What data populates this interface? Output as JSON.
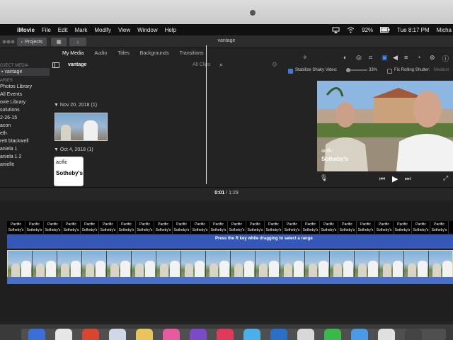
{
  "menubar": {
    "apple": "",
    "app_name": "iMovie",
    "items": [
      "File",
      "Edit",
      "Mark",
      "Modify",
      "View",
      "Window",
      "Help"
    ],
    "battery": "92%",
    "time": "Tue 8:17 PM",
    "user": "Micha"
  },
  "toolbar": {
    "projects_label": "Projects",
    "project_title": "vantage"
  },
  "browser": {
    "tabs": [
      "My Media",
      "Audio",
      "Titles",
      "Backgrounds",
      "Transitions"
    ],
    "library_name": "vantage",
    "filter": "All Clips"
  },
  "sidebar": {
    "header1": "OJECT MEDIA",
    "header2": "ARIES",
    "items": [
      "vantage",
      "Photos Library",
      "All Events",
      "ovie Library",
      "solutions",
      "2-26-15",
      "acon",
      "eth",
      "rett blackwell",
      "aniela 1",
      "aniela 1 2",
      "anielle"
    ]
  },
  "events": [
    {
      "date": "Nov 20, 2018",
      "count": "(1)"
    },
    {
      "date": "Oct 4, 2018",
      "count": "(1)"
    }
  ],
  "thumbs": {
    "pacific_text": "acific",
    "sothebys_text": "Sotheby's"
  },
  "viewer": {
    "stabilize_label": "Stabilize Shaky Video:",
    "stabilize_value": "33%",
    "rolling_label": "Fix Rolling Shutter:",
    "rolling_value": "Medium",
    "overlay_pacific": "acific",
    "overlay_sothebys": "Sotheby's"
  },
  "timeline": {
    "current": "0:01",
    "total": "1:29",
    "separator": "/",
    "range_tip": "Press the R key while dragging to select a range",
    "title_top": "Pacific",
    "title_bottom": "Sotheby's"
  },
  "colors": {
    "accent_blue": "#3558b8",
    "audio_blue": "#4a6fc8",
    "clip_border": "#e8d9a0"
  }
}
